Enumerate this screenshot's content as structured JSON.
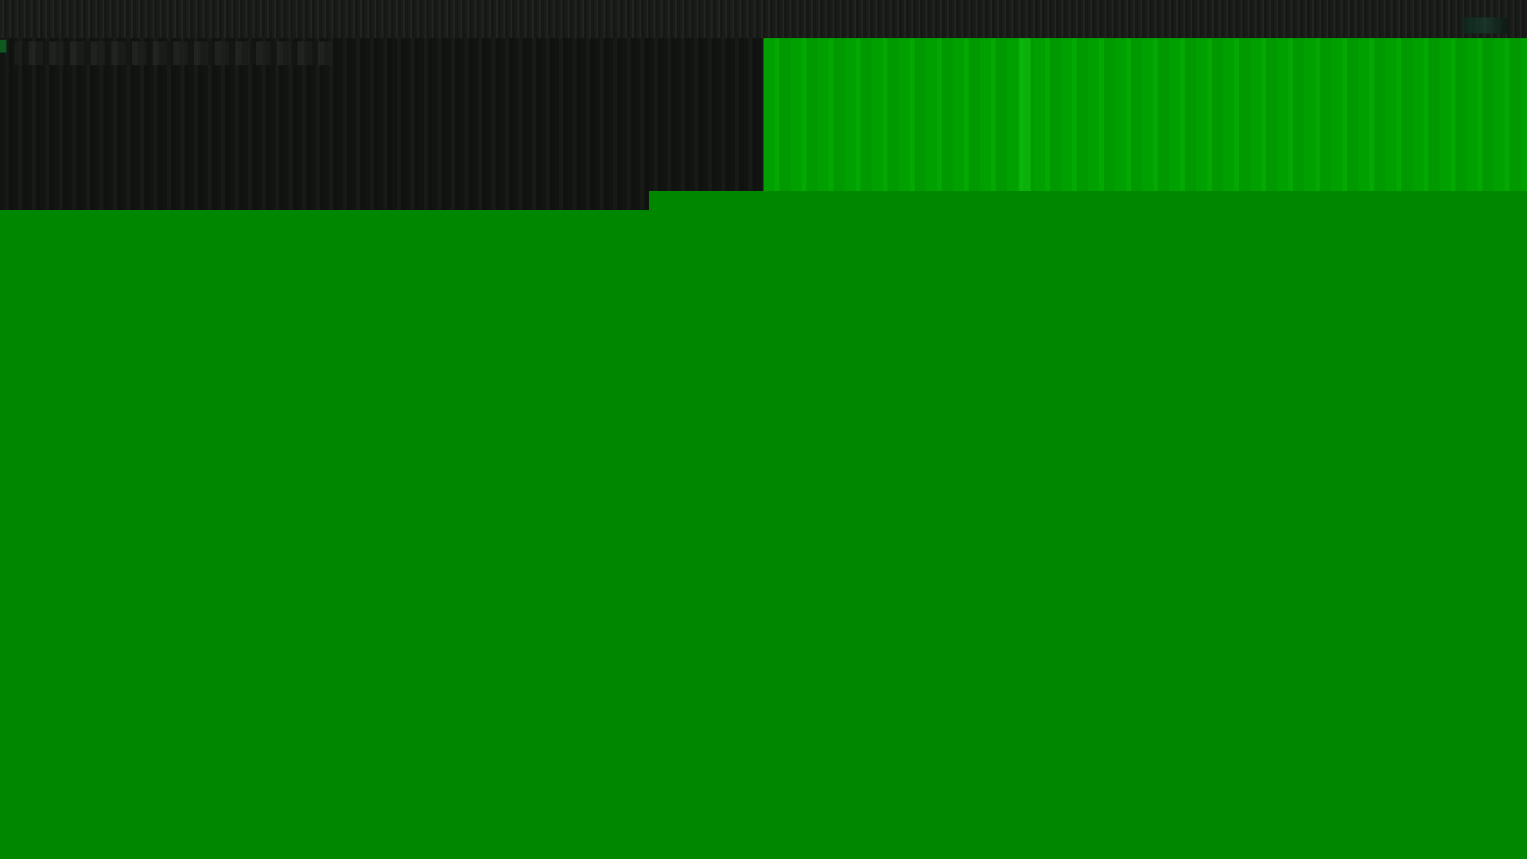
{
  "screen": {
    "colors": {
      "top_strip": "#1a1c1a",
      "dark_panel": "#131513",
      "bright_green": "#00a000",
      "main_green": "#008700"
    },
    "texts": []
  }
}
